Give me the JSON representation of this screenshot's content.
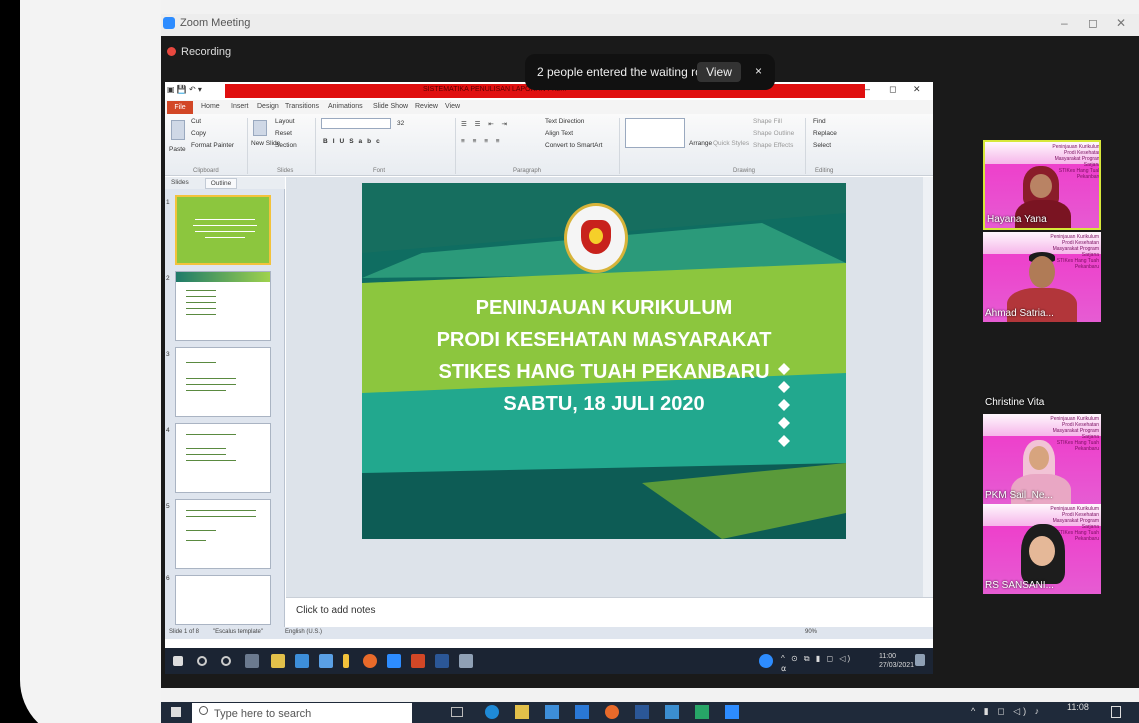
{
  "window": {
    "title": "Zoom Meeting",
    "minimize": "–",
    "maximize": "◻",
    "close": "✕"
  },
  "recording": {
    "label": "Recording"
  },
  "notification": {
    "message": "2 people entered the waiting room",
    "view_label": "View",
    "close": "×"
  },
  "powerpoint": {
    "filename": "SISTEMATIKA PENULISAN LAPORAN PKL...",
    "tabs": [
      "File",
      "Home",
      "Insert",
      "Design",
      "Transitions",
      "Animations",
      "Slide Show",
      "Review",
      "View"
    ],
    "ribbon": {
      "clipboard": {
        "group": "Clipboard",
        "paste": "Paste",
        "cut": "Cut",
        "copy": "Copy",
        "format_painter": "Format Painter"
      },
      "slides": {
        "group": "Slides",
        "new_slide": "New Slide",
        "layout": "Layout",
        "reset": "Reset",
        "section": "Section"
      },
      "font": {
        "group": "Font",
        "size": "32"
      },
      "paragraph": {
        "group": "Paragraph",
        "text_direction": "Text Direction",
        "align_text": "Align Text",
        "smartart": "Convert to SmartArt"
      },
      "drawing": {
        "group": "Drawing",
        "arrange": "Arrange",
        "quick_styles": "Quick Styles",
        "shape_fill": "Shape Fill",
        "shape_outline": "Shape Outline",
        "shape_effects": "Shape Effects"
      },
      "editing": {
        "group": "Editing",
        "find": "Find",
        "replace": "Replace",
        "select": "Select"
      }
    },
    "panel_tabs": {
      "slides": "Slides",
      "outline": "Outline"
    },
    "thumb_numbers": [
      "1",
      "2",
      "3",
      "4",
      "5",
      "6"
    ],
    "slide": {
      "line1": "PENINJAUAN KURIKULUM",
      "line2": "PRODI KESEHATAN MASYARAKAT",
      "line3": "STIKES HANG TUAH PEKANBARU",
      "line4": "SABTU, 18 JULI 2020"
    },
    "notes_placeholder": "Click to add notes",
    "status": {
      "slide_of": "Slide 1 of 8",
      "theme": "\"Escalus template\"",
      "language": "English (U.S.)",
      "zoom": "90%"
    }
  },
  "inner_clock": {
    "time": "11:00",
    "date": "27/03/2021"
  },
  "participants": [
    {
      "name": "Hayana Yana"
    },
    {
      "name": "Ahmad Satria..."
    },
    {
      "name": "Christine Vita"
    },
    {
      "name": "PKM Sail_Ne..."
    },
    {
      "name": "RS SANSANI..."
    }
  ],
  "tile_header": {
    "line1": "Peninjauan Kurikulum",
    "line2": "Prodi Kesehatan Masyarakat Program Sarjana",
    "line3": "STIKes Hang Tuah Pekanbaru"
  },
  "taskbar": {
    "search_placeholder": "Type here to search",
    "time": "11:08"
  },
  "colors": {
    "zoom_accent": "#2d8cff",
    "record_red": "#e8483f",
    "slide_green": "#8cc63e",
    "slide_teal": "#0f6d61",
    "ppt_red": "#e01010",
    "participant_pink": "#f037c9"
  }
}
